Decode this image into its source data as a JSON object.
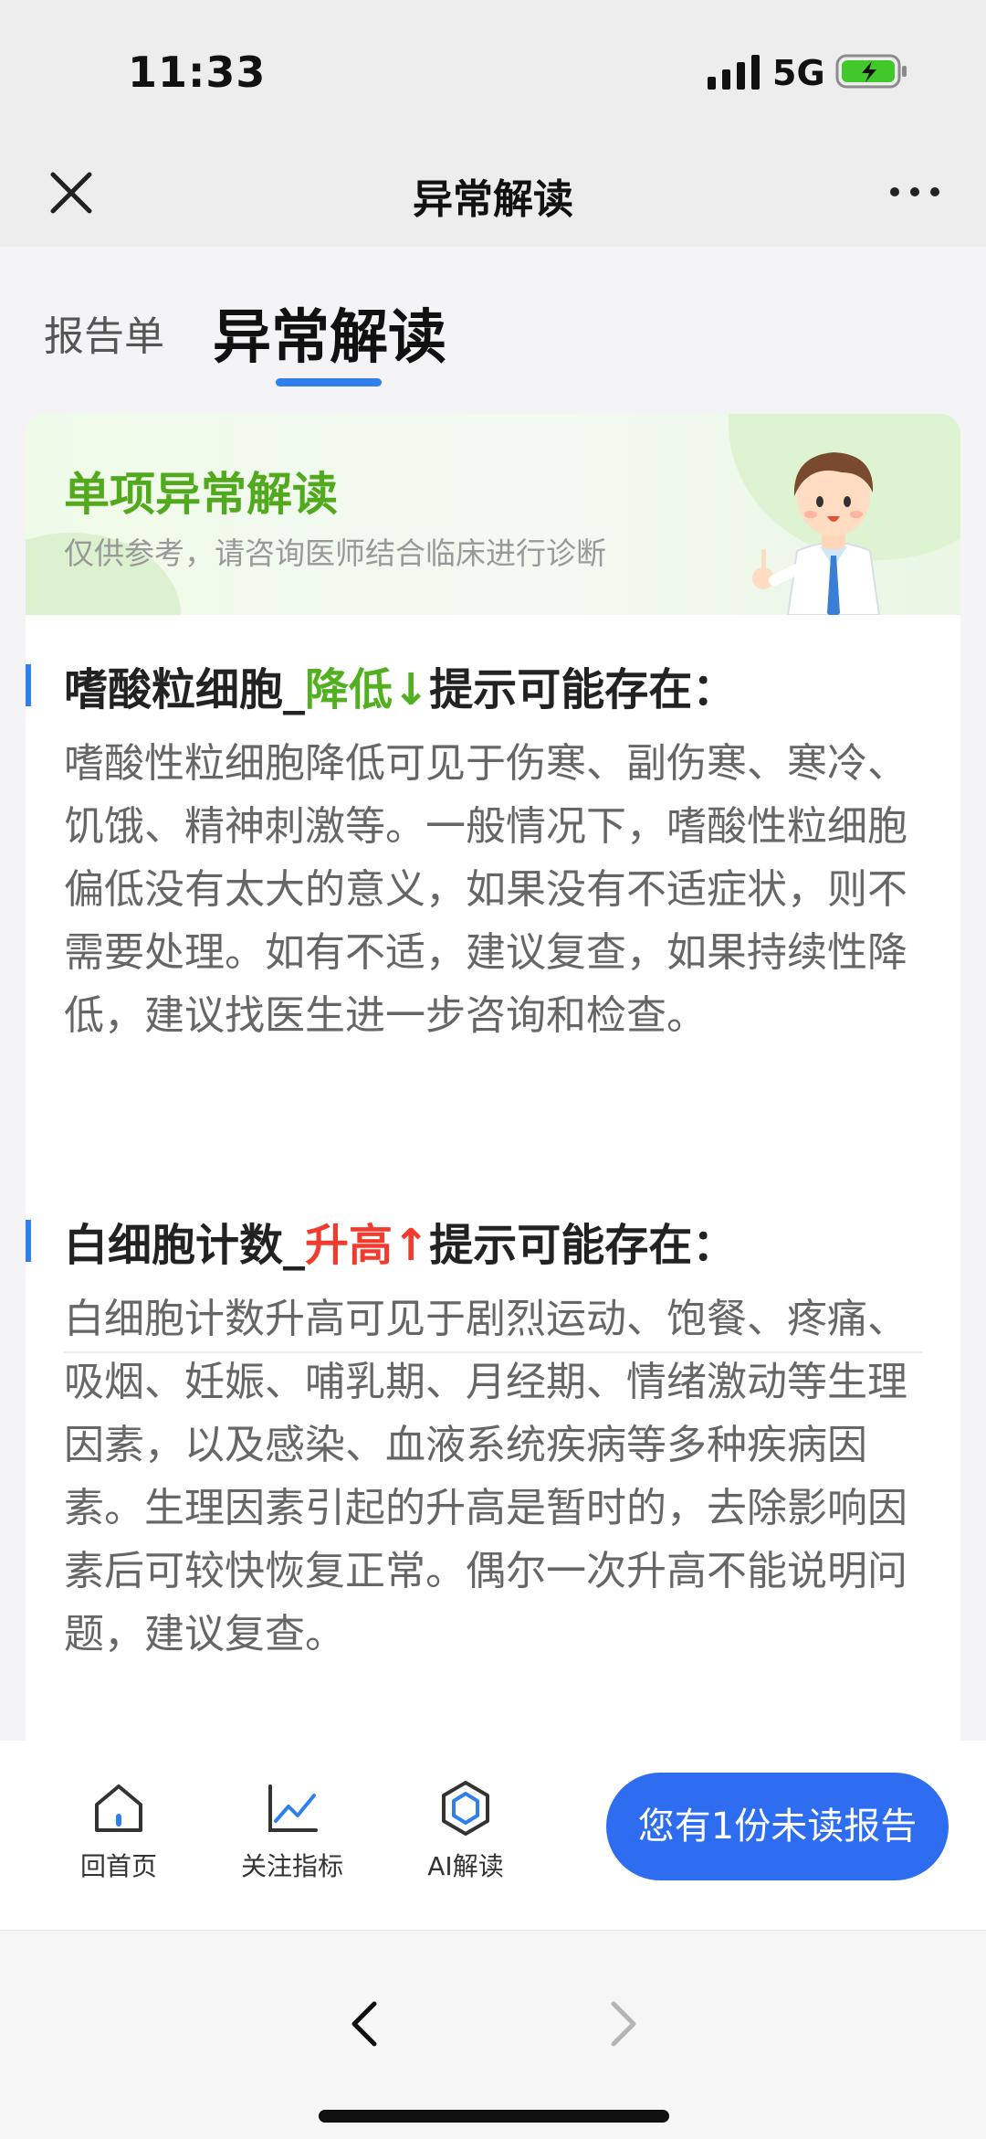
{
  "status_bar": {
    "time": "11:33",
    "network": "5G"
  },
  "nav": {
    "title": "异常解读"
  },
  "tabs": [
    {
      "label": "报告单"
    },
    {
      "label": "异常解读"
    }
  ],
  "banner": {
    "title": "单项异常解读",
    "subtitle": "仅供参考，请咨询医师结合临床进行诊断"
  },
  "sections": [
    {
      "item": "嗜酸粒细胞_",
      "trend": "降低",
      "arrow": "↓",
      "suffix": "提示可能存在：",
      "body": "嗜酸性粒细胞降低可见于伤寒、副伤寒、寒冷、饥饿、精神刺激等。一般情况下，嗜酸性粒细胞偏低没有太大的意义，如果没有不适症状，则不需要处理。如有不适，建议复查，如果持续性降低，建议找医生进一步咨询和检查。"
    },
    {
      "item": "白细胞计数_",
      "trend": "升高",
      "arrow": "↑",
      "suffix": "提示可能存在：",
      "body": "白细胞计数升高可见于剧烈运动、饱餐、疼痛、吸烟、妊娠、哺乳期、月经期、情绪激动等生理因素，以及感染、血液系统疾病等多种疾病因素。生理因素引起的升高是暂时的，去除影响因素后可较快恢复正常。偶尔一次升高不能说明问题，建议复查。"
    }
  ],
  "bottom_bar": {
    "home": "回首页",
    "follow": "关注指标",
    "ai": "AI解读",
    "unread_button": "您有1份未读报告"
  },
  "colors": {
    "accent": "#2f80ed",
    "low": "#52b020",
    "high": "#f23b2f",
    "banner_title": "#52a91e",
    "button": "#2f6df0"
  }
}
